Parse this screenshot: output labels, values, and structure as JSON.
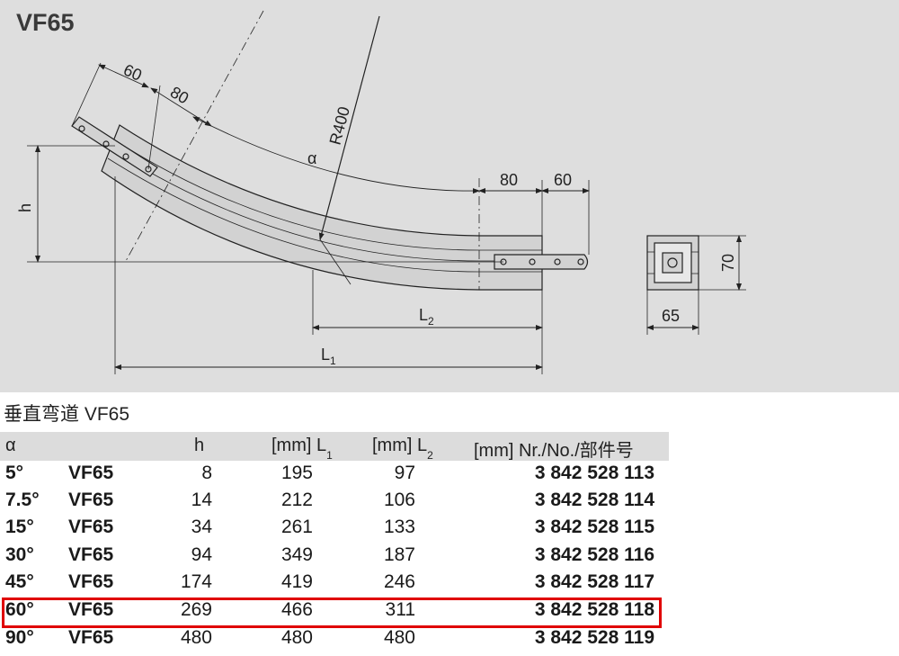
{
  "drawing": {
    "title": "VF65",
    "labels": {
      "dim_60_top": "60",
      "dim_80_top": "80",
      "radius": "R400",
      "angle": "α",
      "dim_80_right": "80",
      "dim_60_right": "60",
      "height": "h",
      "l2": "L",
      "l2_sub": "2",
      "l1": "L",
      "l1_sub": "1",
      "profile_height": "70",
      "profile_width": "65"
    }
  },
  "table": {
    "caption": "垂直弯道 VF65",
    "headers": {
      "alpha": "α",
      "h": "h",
      "l1": "[mm] L",
      "l1_sub": "1",
      "l2": "[mm] L",
      "l2_sub": "2",
      "part": "[mm] Nr./No./部件号"
    },
    "rows": [
      {
        "angle": "5°",
        "type": "VF65",
        "h": "8",
        "l1": "195",
        "l2": "97",
        "part": "3 842 528 113"
      },
      {
        "angle": "7.5°",
        "type": "VF65",
        "h": "14",
        "l1": "212",
        "l2": "106",
        "part": "3 842 528 114"
      },
      {
        "angle": "15°",
        "type": "VF65",
        "h": "34",
        "l1": "261",
        "l2": "133",
        "part": "3 842 528 115"
      },
      {
        "angle": "30°",
        "type": "VF65",
        "h": "94",
        "l1": "349",
        "l2": "187",
        "part": "3 842 528 116"
      },
      {
        "angle": "45°",
        "type": "VF65",
        "h": "174",
        "l1": "419",
        "l2": "246",
        "part": "3 842 528 117"
      },
      {
        "angle": "60°",
        "type": "VF65",
        "h": "269",
        "l1": "466",
        "l2": "311",
        "part": "3 842 528 118"
      },
      {
        "angle": "90°",
        "type": "VF65",
        "h": "480",
        "l1": "480",
        "l2": "480",
        "part": "3 842 528 119"
      }
    ],
    "highlighted_row": 5,
    "highlight_color": "#e00000"
  }
}
